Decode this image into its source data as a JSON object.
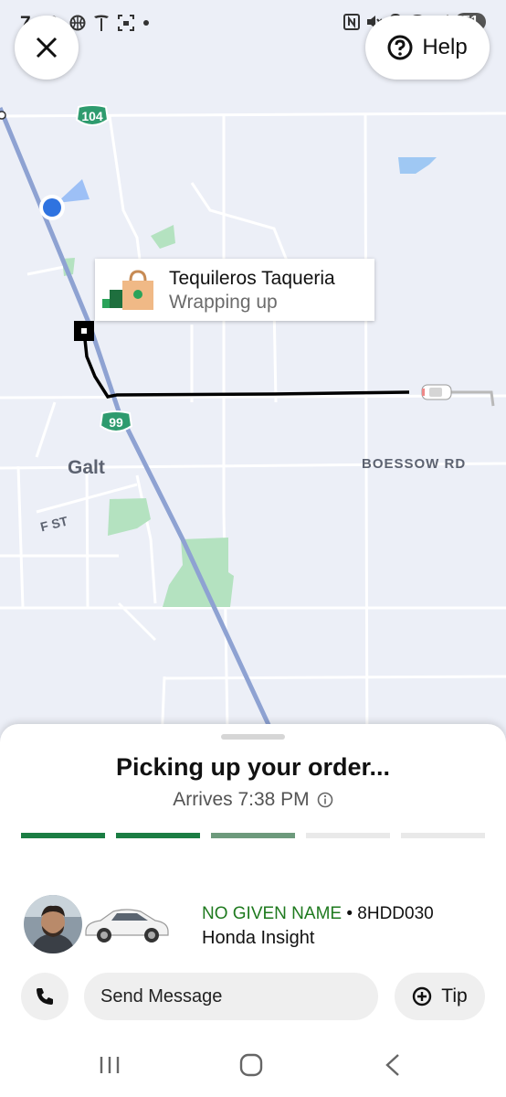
{
  "status_bar": {
    "time": "7:30",
    "left_icons": [
      "basketball-icon",
      "tesla-icon",
      "screenshot-icon",
      "dot-icon"
    ],
    "right_icons": [
      "nfc-icon",
      "mute-icon",
      "location-icon",
      "wifi-icon",
      "signal-icon"
    ],
    "battery": "51"
  },
  "map": {
    "help_label": "Help",
    "restaurant_name": "Tequileros Taqueria",
    "restaurant_status": "Wrapping up",
    "city_label": "Galt",
    "road_boessow": "BOESSOW RD",
    "road_fst": "F ST",
    "highway_104": "104",
    "highway_99": "99",
    "colors": {
      "map_bg": "#eceff7",
      "highway": "#8ea2d2",
      "route": "#000000",
      "park": "#b4e2c0",
      "water": "#9fc8f3",
      "user_dot": "#2f73e0",
      "shield": "#2e9b6e"
    }
  },
  "order": {
    "title": "Picking up your order...",
    "eta": "Arrives 7:38 PM",
    "progress": [
      1,
      1,
      0.7,
      0,
      0
    ],
    "progress_colors": {
      "done": "#1b7d43",
      "partial": "#6d9a7c",
      "empty": "#e9e9e9"
    }
  },
  "driver": {
    "name": "NO GIVEN NAME",
    "separator": " • ",
    "plate": "8HDD030",
    "car": "Honda Insight"
  },
  "actions": {
    "message_placeholder": "Send Message",
    "tip_label": "Tip"
  },
  "nav_bar": [
    "recent-apps-icon",
    "home-icon",
    "back-icon"
  ]
}
